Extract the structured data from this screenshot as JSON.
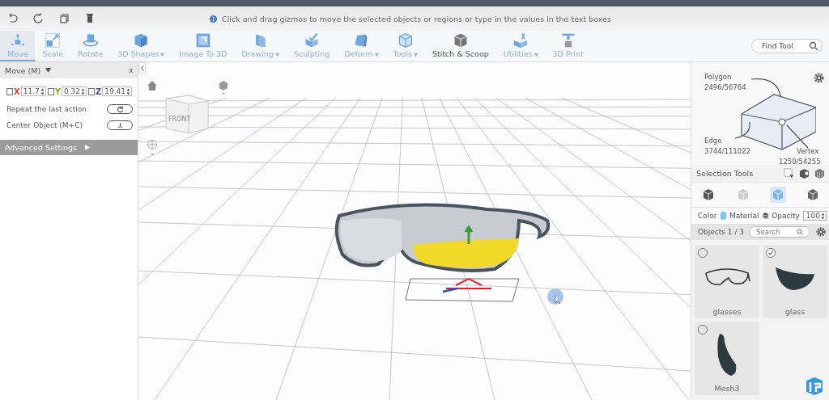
{
  "quick_bar": {
    "message": "Click and drag gizmos to move the selected objects or regions or type in the values in the text boxes"
  },
  "tools": [
    {
      "label": "Move",
      "kind": "move",
      "selected": true,
      "dropdown": false
    },
    {
      "label": "Scale",
      "kind": "scale",
      "selected": false,
      "dropdown": false
    },
    {
      "label": "Rotate",
      "kind": "rotate",
      "selected": false,
      "dropdown": false
    },
    {
      "label": "3D Shapes",
      "kind": "cube",
      "selected": false,
      "dropdown": true
    },
    {
      "label": "Image To 3D",
      "kind": "image",
      "selected": false,
      "dropdown": false
    },
    {
      "label": "Drawing",
      "kind": "drawing",
      "selected": false,
      "dropdown": true
    },
    {
      "label": "Sculpting",
      "kind": "sculpt",
      "selected": false,
      "dropdown": false
    },
    {
      "label": "Deform",
      "kind": "deform",
      "selected": false,
      "dropdown": true
    },
    {
      "label": "Tools",
      "kind": "tools",
      "selected": false,
      "dropdown": true
    },
    {
      "label": "Stitch & Scoop",
      "kind": "stitch",
      "selected": false,
      "dropdown": false
    },
    {
      "label": "Utilities",
      "kind": "utilities",
      "selected": false,
      "dropdown": true
    },
    {
      "label": "3D Print",
      "kind": "print",
      "selected": false,
      "dropdown": false
    }
  ],
  "find_tool": {
    "placeholder": "Find Tool"
  },
  "move_panel": {
    "title": "Move (M)",
    "close": "x",
    "axes": [
      {
        "label": "X",
        "value": "11.7",
        "checked": false,
        "color": "#e0442f"
      },
      {
        "label": "Y",
        "value": "0.32",
        "checked": false,
        "color": "#a8a31c"
      },
      {
        "label": "Z",
        "value": "19.41",
        "checked": false,
        "color": "#3f4fc0"
      }
    ],
    "actions": [
      {
        "label": "Repeat the last action",
        "kind": "repeat"
      },
      {
        "label": "Center Object (M+C)",
        "kind": "center"
      }
    ],
    "advanced": "Advanced Settings"
  },
  "viewport": {
    "cube_label": "FRONT"
  },
  "selection_panel": {
    "polygon": {
      "label": "Polygon",
      "count": "2496/56764"
    },
    "edge": {
      "label": "Edge",
      "count": "3744/111022"
    },
    "vertex": {
      "label": "Vertex",
      "count": "1250/54255"
    },
    "title": "Selection Tools",
    "modes": [
      {
        "kind": "solid",
        "selected": false
      },
      {
        "kind": "wire",
        "selected": false
      },
      {
        "kind": "faces",
        "selected": true
      },
      {
        "kind": "shell",
        "selected": false
      }
    ]
  },
  "appearance": {
    "color_label": "Color",
    "color": "#7cc4f4",
    "material_label": "Material",
    "opacity_label": "Opacity",
    "opacity": "100"
  },
  "objects": {
    "title": "Objects 1 / 3",
    "search_placeholder": "Search",
    "items": [
      {
        "name": "glasses",
        "kind": "glasses",
        "checked": false
      },
      {
        "name": "glass",
        "kind": "lens",
        "checked": true
      },
      {
        "name": "Mesh3",
        "kind": "arm",
        "checked": false
      }
    ]
  }
}
